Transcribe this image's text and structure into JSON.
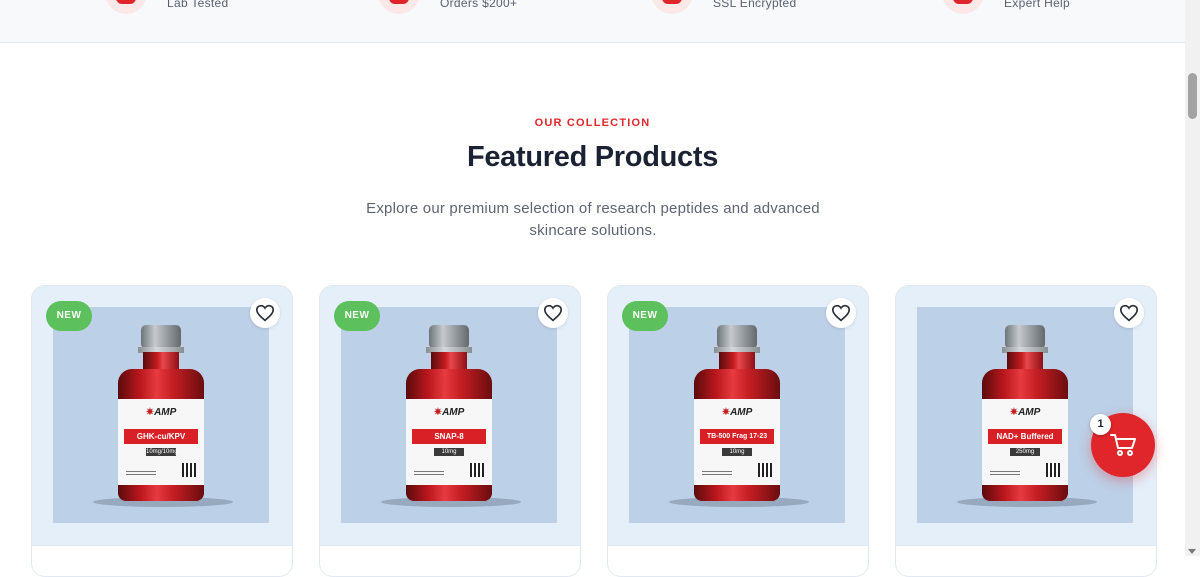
{
  "trust_bar": [
    {
      "icon": "shield-icon",
      "text": "Lab Tested"
    },
    {
      "icon": "truck-icon",
      "text": "Orders $200+"
    },
    {
      "icon": "lock-icon",
      "text": "SSL Encrypted"
    },
    {
      "icon": "support-icon",
      "text": "Expert Help"
    }
  ],
  "section": {
    "eyebrow": "OUR COLLECTION",
    "title": "Featured Products",
    "description": "Explore our premium selection of research peptides and advanced skincare solutions."
  },
  "products": [
    {
      "badge": "NEW",
      "brand": "AMP",
      "label_name": "GHK-cu/KPV",
      "label_dose": "10mg/10mg"
    },
    {
      "badge": "NEW",
      "brand": "AMP",
      "label_name": "SNAP-8",
      "label_dose": "10mg"
    },
    {
      "badge": "NEW",
      "brand": "AMP",
      "label_name": "TB-500 Frag 17-23",
      "label_dose": "10mg"
    },
    {
      "badge": "",
      "brand": "AMP",
      "label_name": "NAD+ Buffered",
      "label_dose": "250mg"
    }
  ],
  "cart": {
    "count": "1",
    "icon": "cart-icon"
  },
  "colors": {
    "accent": "#e0262b",
    "badge_green": "#5cc05d",
    "card_bg": "#e4effa"
  }
}
